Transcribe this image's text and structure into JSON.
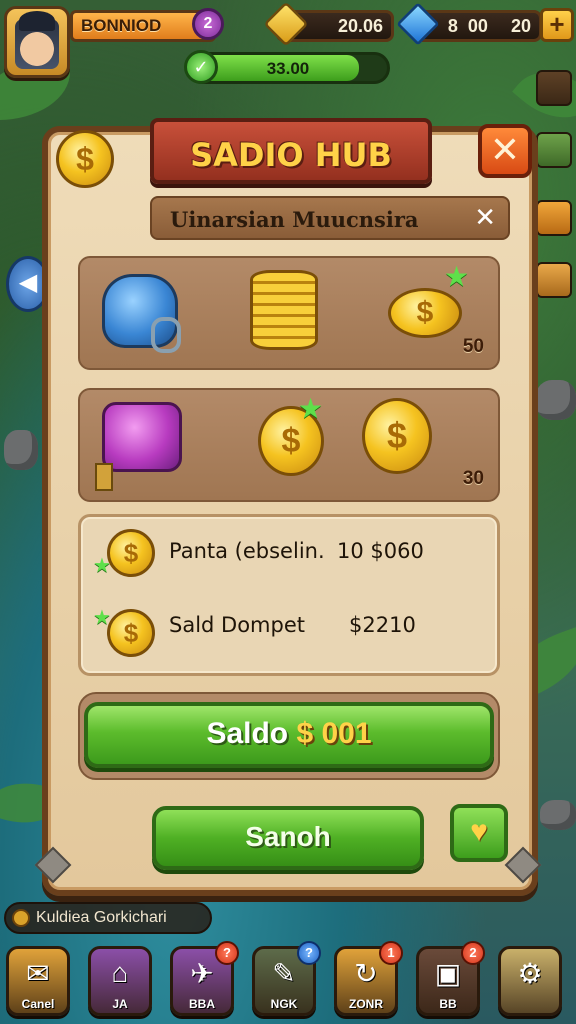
{
  "hud": {
    "player_name": "BONNIOD",
    "level": "2",
    "xp_value": "33.00",
    "xp_progress": 0.86,
    "gold_amount": "20.06",
    "gem_amount": "8  00",
    "gem_count": "20",
    "plus_label": "+"
  },
  "panel": {
    "title": "SADIO HUB",
    "close_glyph": "✕",
    "coin_glyph": "$",
    "subheader": "Uinarsian Muucnsira",
    "subheader_close": "✕",
    "row1": {
      "count": "50",
      "coin_glyph": "$"
    },
    "row2": {
      "count": "30",
      "coin_a_glyph": "$",
      "coin_b_glyph": "$"
    },
    "info": {
      "line1_label": "Panta (ebselin.",
      "line1_value": "10 $060",
      "line2_label": "Sald Dompet",
      "line2_value": "$2210",
      "coin_glyph": "$"
    },
    "saldo_prefix": "Saldo",
    "saldo_amount": "$ 001",
    "primary_button": "Sanoh",
    "heart_glyph": "♥"
  },
  "bottom": {
    "quest_text": "Kuldiea Gorkichari",
    "dock": [
      {
        "label": "Canel",
        "glyph": "✉",
        "badge": "",
        "color": "#e0a23a"
      },
      {
        "label": "JA",
        "glyph": "⌂",
        "badge": "",
        "color": "#8b4fa8"
      },
      {
        "label": "BBA",
        "glyph": "✈",
        "badge": "?",
        "color": "#8b4fa8"
      },
      {
        "label": "NGK",
        "glyph": "✎",
        "badge": "?",
        "color": "#5d6b4a"
      },
      {
        "label": "ZONR",
        "glyph": "↻",
        "badge": "1",
        "color": "#e0a23a"
      },
      {
        "label": "BB",
        "glyph": "▣",
        "badge": "2",
        "color": "#6a4a3a"
      },
      {
        "label": "",
        "glyph": "⚙",
        "badge": "",
        "color": "#c9b06a"
      }
    ]
  },
  "colors": {
    "panel_bg": "#e3c89c",
    "title_red": "#94301f",
    "button_green": "#5cbc2c",
    "gold": "#f5c320"
  }
}
